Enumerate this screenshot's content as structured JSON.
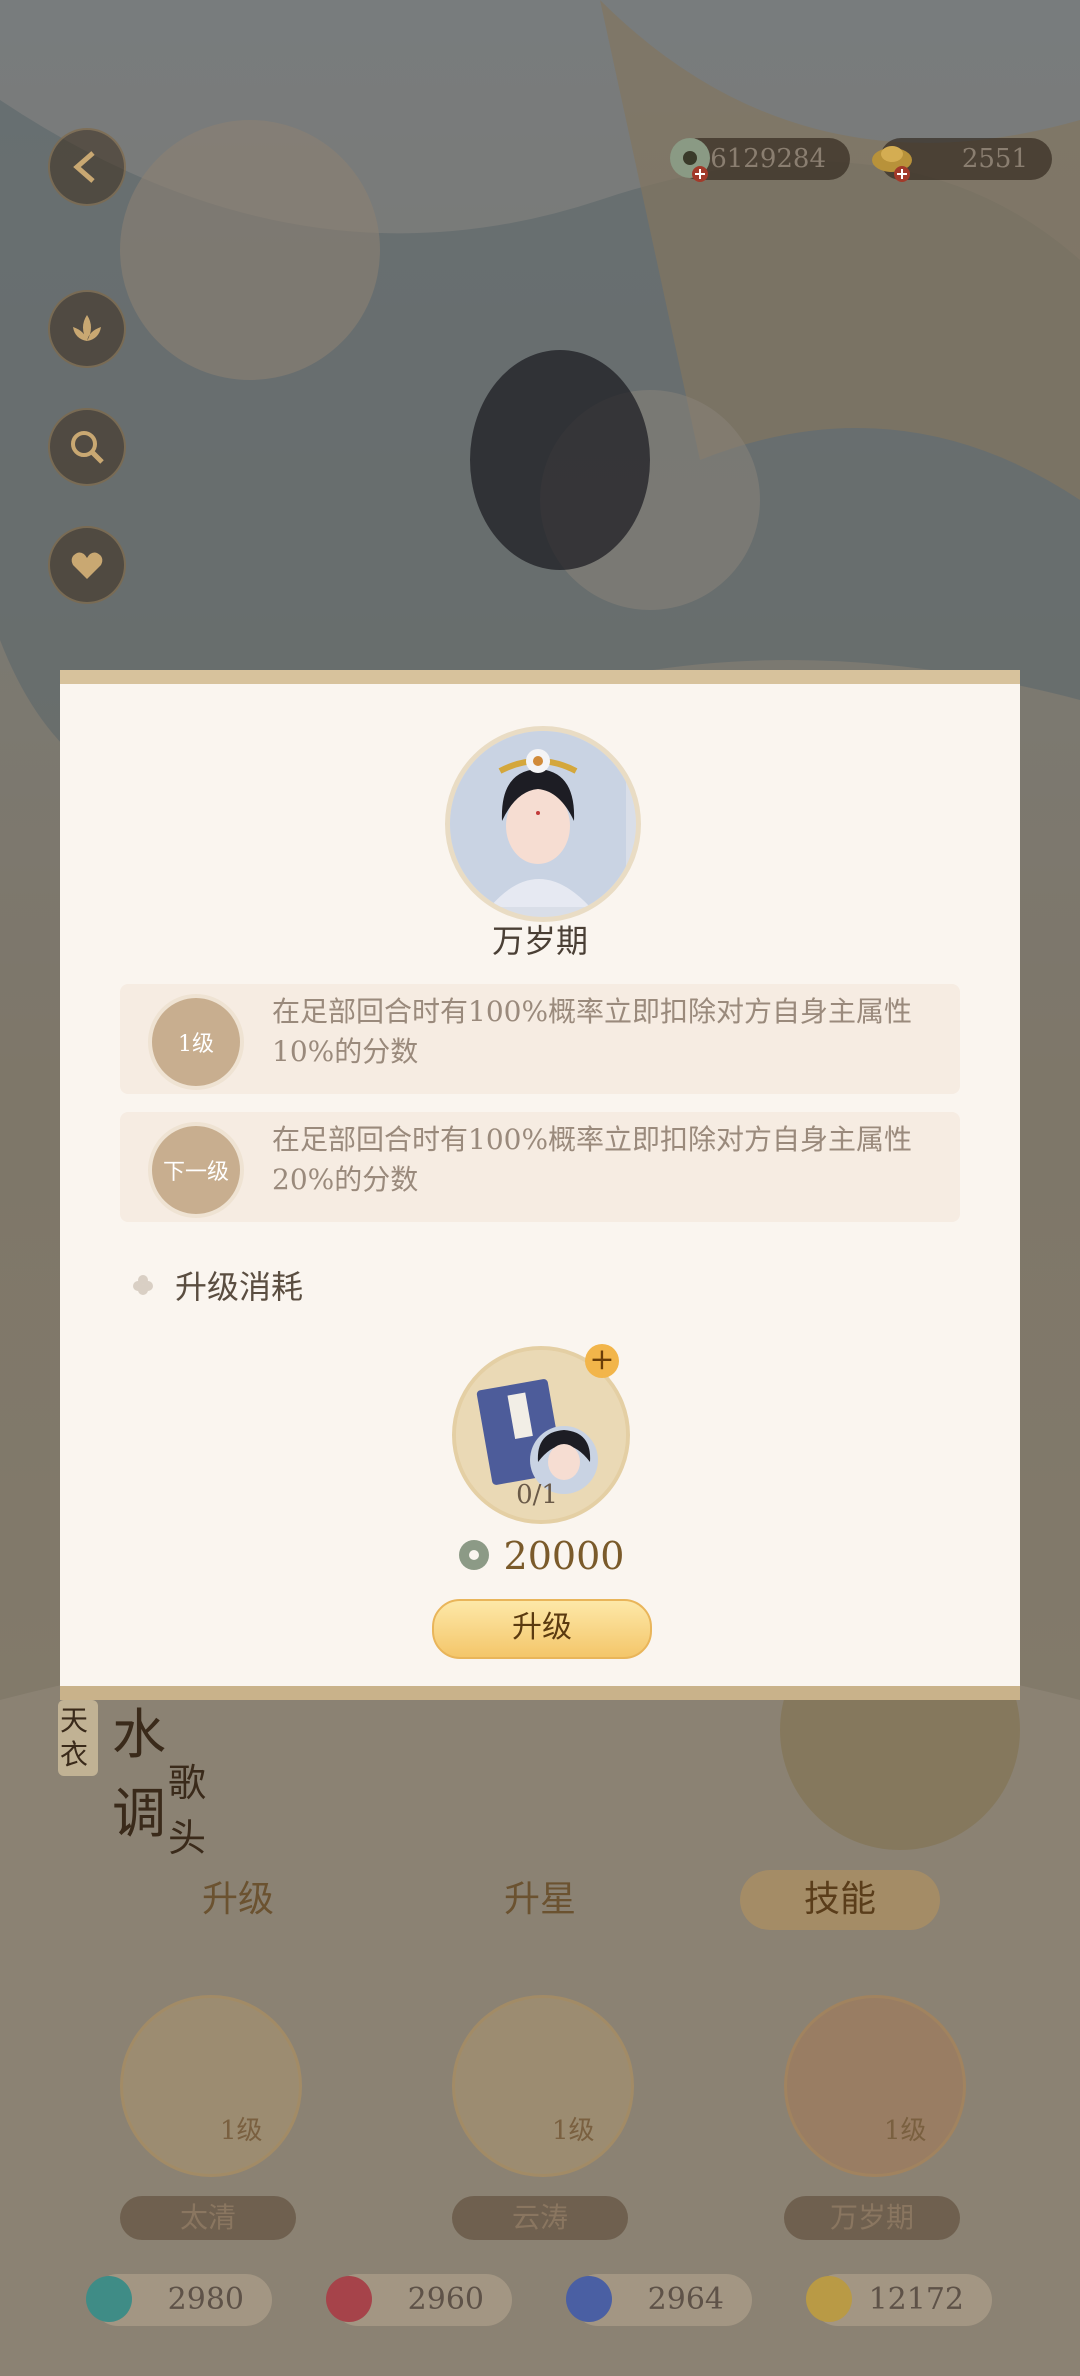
{
  "currencies": [
    {
      "name": "jade-coin",
      "value": "6129284"
    },
    {
      "name": "gold-ingot",
      "value": "2551"
    }
  ],
  "modal": {
    "skill_name": "万岁期",
    "levels": [
      {
        "badge": "1级",
        "text": "在足部回合时有100%概率立即扣除对方自身主属性10%的分数"
      },
      {
        "badge": "下一级",
        "text": "在足部回合时有100%概率立即扣除对方自身主属性20%的分数"
      }
    ],
    "section_title": "升级消耗",
    "item_count": "0/1",
    "cost": "20000",
    "upgrade_label": "升级"
  },
  "poem": {
    "left": "天衣",
    "main": "水调",
    "sub": "歌头"
  },
  "tabs": [
    {
      "label": "升级",
      "active": false
    },
    {
      "label": "升星",
      "active": false
    },
    {
      "label": "技能",
      "active": true
    }
  ],
  "skills": [
    {
      "level": "1级",
      "name": "太清"
    },
    {
      "level": "1级",
      "name": "云涛"
    },
    {
      "level": "1级",
      "name": "万岁期"
    }
  ],
  "stats": [
    {
      "icon": "teal-flower",
      "value": "2980"
    },
    {
      "icon": "red-lotus",
      "value": "2960"
    },
    {
      "icon": "blue-snowflake",
      "value": "2964"
    },
    {
      "icon": "gold-moon",
      "value": "12172"
    }
  ],
  "colors": {
    "accent": "#d7c29c",
    "button": "#f4c66a",
    "modal_bg": "#faf5ef"
  }
}
